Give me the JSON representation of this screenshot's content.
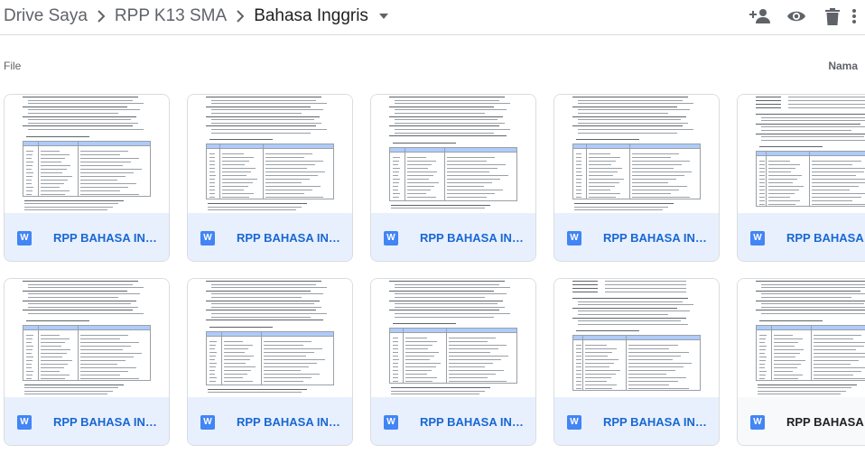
{
  "breadcrumb": {
    "items": [
      "Drive Saya",
      "RPP K13 SMA"
    ],
    "current": "Bahasa Inggris"
  },
  "actions": [
    {
      "name": "share-person-add-icon",
      "label": "person-add"
    },
    {
      "name": "preview-eye-icon",
      "label": "eye"
    },
    {
      "name": "trash-icon",
      "label": "trash"
    },
    {
      "name": "more-vert-icon",
      "label": "more"
    }
  ],
  "section": {
    "label": "File",
    "sort_label": "Nama"
  },
  "files": [
    {
      "name": "RPP BAHASA INGGRIS",
      "icon_letter": "W",
      "variant": "a"
    },
    {
      "name": "RPP BAHASA INGGRIS",
      "icon_letter": "W",
      "variant": "b"
    },
    {
      "name": "RPP BAHASA INGGRIS",
      "icon_letter": "W",
      "variant": "c"
    },
    {
      "name": "RPP BAHASA INGGRIS",
      "icon_letter": "W",
      "variant": "b"
    },
    {
      "name": "RPP BAHASA INGGRIS",
      "icon_letter": "W",
      "variant": "d"
    },
    {
      "name": "RPP BAHASA INGGRIS",
      "icon_letter": "W",
      "variant": "a"
    },
    {
      "name": "RPP BAHASA INGGRIS",
      "icon_letter": "W",
      "variant": "c"
    },
    {
      "name": "RPP BAHASA INGGRIS",
      "icon_letter": "W",
      "variant": "b"
    },
    {
      "name": "RPP BAHASA INGGRIS",
      "icon_letter": "W",
      "variant": "d"
    },
    {
      "name": "RPP BAHASA IN",
      "icon_letter": "W",
      "variant": "a",
      "partial": true
    }
  ],
  "colors": {
    "accent_blue": "#1967d2",
    "card_footer": "#e8f0fe",
    "word_icon": "#4285f4",
    "icon_gray": "#5f6368"
  }
}
